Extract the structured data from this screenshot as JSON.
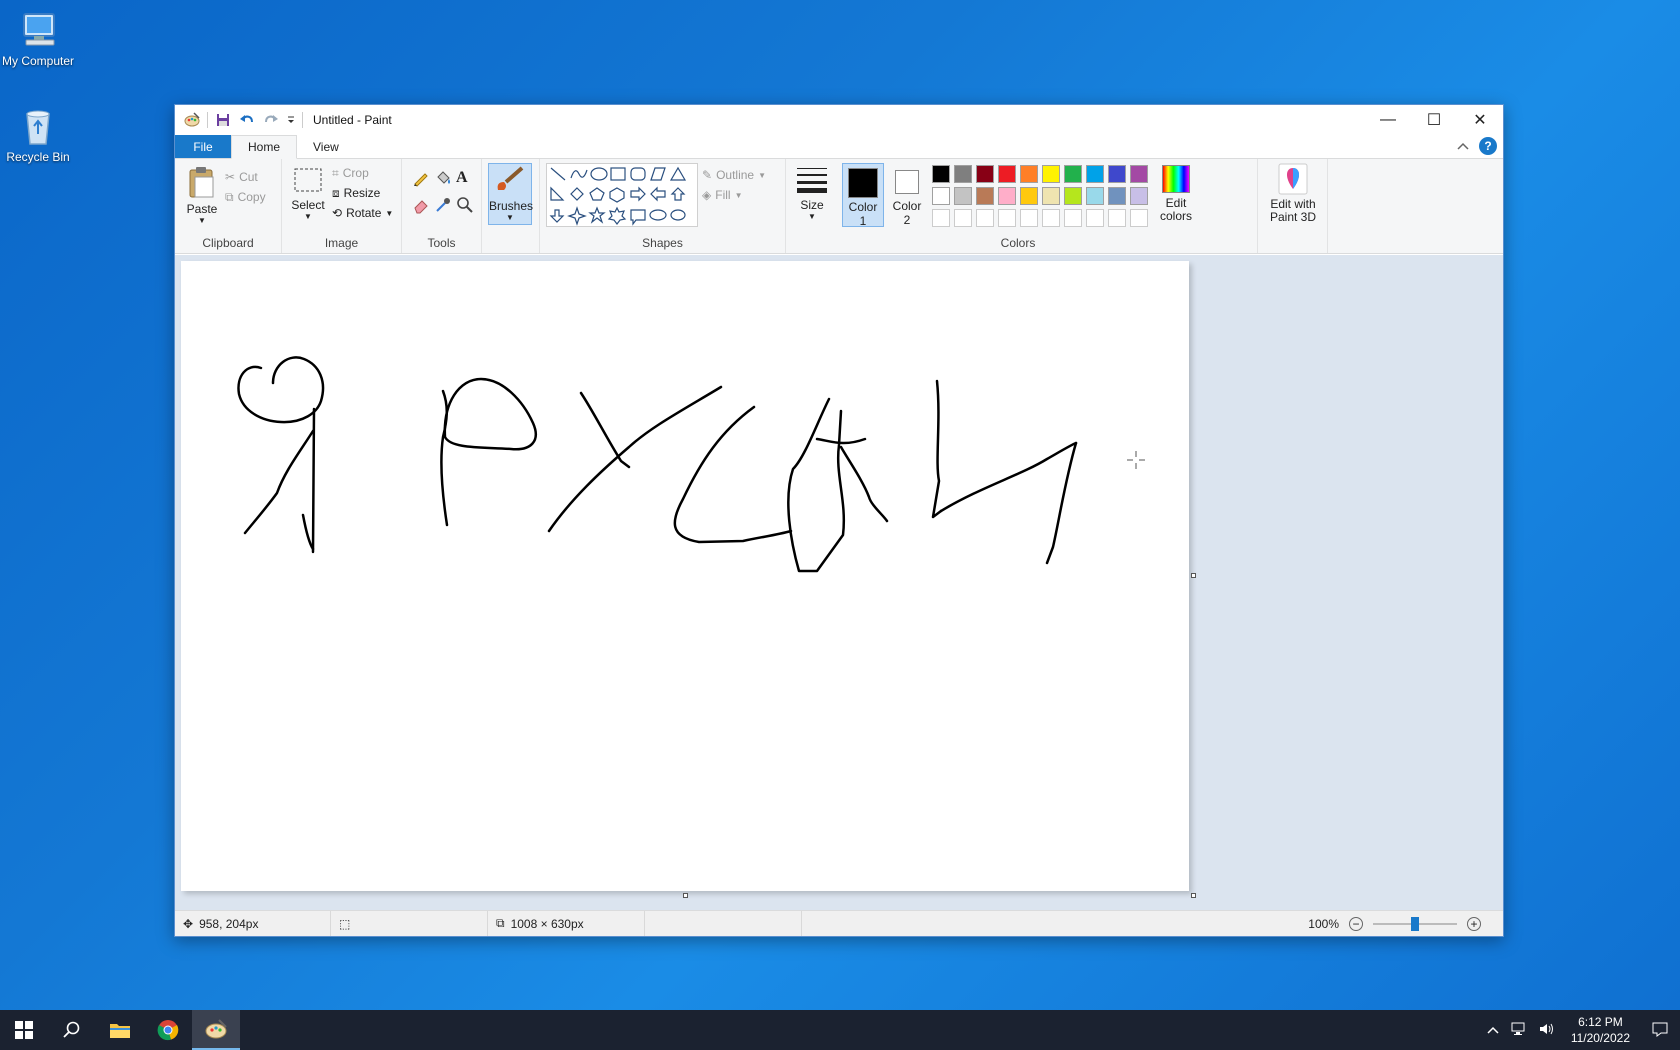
{
  "desktop": {
    "icons": [
      {
        "label": "My Computer"
      },
      {
        "label": "Recycle Bin"
      }
    ]
  },
  "window": {
    "title": "Untitled - Paint",
    "controls": {
      "minimize": "—",
      "maximize": "☐",
      "close": "✕"
    }
  },
  "tabs": {
    "file": "File",
    "home": "Home",
    "view": "View"
  },
  "ribbon": {
    "clipboard": {
      "paste": "Paste",
      "cut": "Cut",
      "copy": "Copy",
      "label": "Clipboard"
    },
    "image": {
      "select": "Select",
      "crop": "Crop",
      "resize": "Resize",
      "rotate": "Rotate",
      "label": "Image"
    },
    "tools": {
      "label": "Tools"
    },
    "brushes": {
      "label": "Brushes"
    },
    "shapes": {
      "outline": "Outline",
      "fill": "Fill",
      "label": "Shapes"
    },
    "size": {
      "label": "Size"
    },
    "color1": {
      "label": "Color",
      "num": "1",
      "value": "#000000"
    },
    "color2": {
      "label": "Color",
      "num": "2",
      "value": "#ffffff"
    },
    "colors": {
      "label": "Colors",
      "row1": [
        "#000000",
        "#7f7f7f",
        "#880015",
        "#ed1c24",
        "#ff7f27",
        "#fff200",
        "#22b14c",
        "#00a2e8",
        "#3f48cc",
        "#a349a4"
      ],
      "row2": [
        "#ffffff",
        "#c3c3c3",
        "#b97a57",
        "#ffaec9",
        "#ffc90e",
        "#efe4b0",
        "#b5e61d",
        "#99d9ea",
        "#7092be",
        "#c8bfe7"
      ],
      "row3": [
        "#ffffff",
        "#ffffff",
        "#ffffff",
        "#ffffff",
        "#ffffff",
        "#ffffff",
        "#ffffff",
        "#ffffff",
        "#ffffff",
        "#ffffff"
      ]
    },
    "edit_colors": {
      "line1": "Edit",
      "line2": "colors"
    },
    "paint3d": {
      "line1": "Edit with",
      "line2": "Paint 3D"
    }
  },
  "status": {
    "cursor_pos": "958, 204px",
    "selection": "",
    "canvas_size": "1008 × 630px",
    "zoom": "100%",
    "zoom_value": 0.5
  },
  "taskbar": {
    "time": "6:12 PM",
    "date": "11/20/2022"
  }
}
